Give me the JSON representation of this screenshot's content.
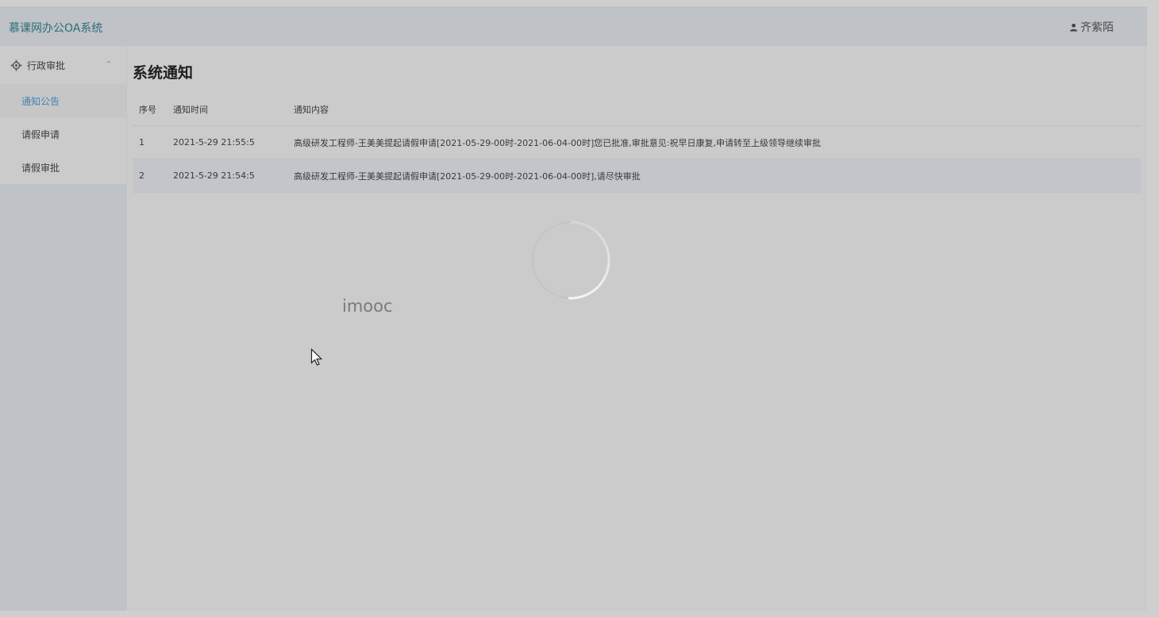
{
  "header": {
    "brand": "慕课网办公OA系统",
    "user_name": "齐紫陌"
  },
  "sidebar": {
    "group_label": "行政审批",
    "items": [
      {
        "label": "通知公告",
        "active": true
      },
      {
        "label": "请假申请",
        "active": false
      },
      {
        "label": "请假审批",
        "active": false
      }
    ]
  },
  "main": {
    "title": "系统通知",
    "columns": [
      "序号",
      "通知时间",
      "通知内容"
    ],
    "rows": [
      {
        "no": "1",
        "time": "2021-5-29 21:55:5",
        "content": "高级研发工程师-王美美提起请假申请[2021-05-29-00时-2021-06-04-00时]您已批准,审批意见:祝早日康复,申请转至上级领导继续审批"
      },
      {
        "no": "2",
        "time": "2021-5-29 21:54:5",
        "content": "高级研发工程师-王美美提起请假申请[2021-05-29-00时-2021-06-04-00时],请尽快审批"
      }
    ]
  },
  "overlay": {
    "watermark": "imooc"
  },
  "colors": {
    "brand_text": "#2c6d78",
    "active_menu": "#3f83b5"
  }
}
